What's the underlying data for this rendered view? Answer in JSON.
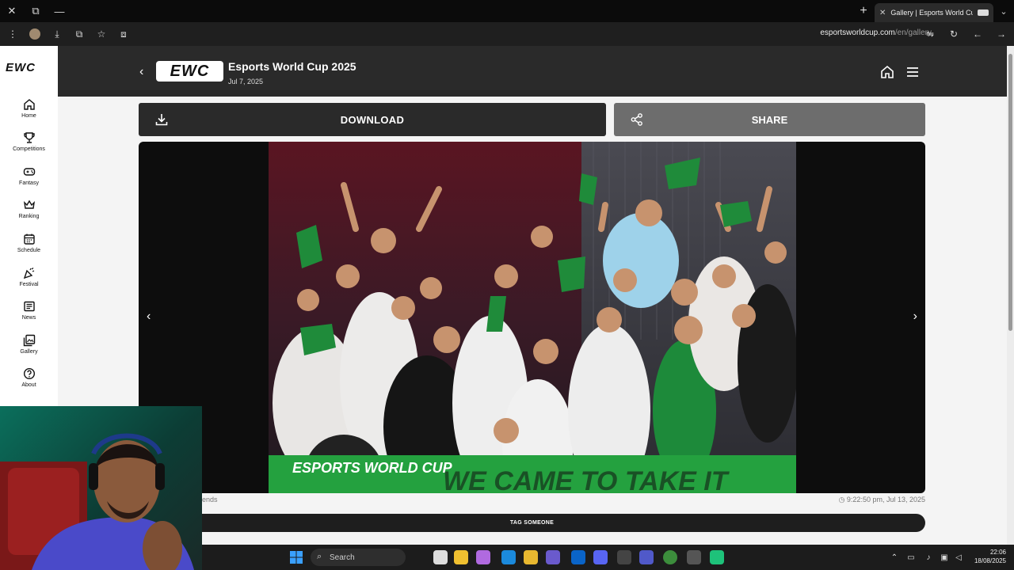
{
  "browser": {
    "tab_title": "Gallery | Esports World Cup",
    "url_domain": "esportsworldcup.com",
    "url_path": "/en/gallery"
  },
  "sidebar": {
    "logo": "EWC",
    "items": [
      {
        "label": "Home",
        "icon": "home-icon"
      },
      {
        "label": "Competitions",
        "icon": "trophy-icon"
      },
      {
        "label": "Fantasy",
        "icon": "gamepad-icon"
      },
      {
        "label": "Ranking",
        "icon": "crown-icon"
      },
      {
        "label": "Schedule",
        "icon": "calendar-icon"
      },
      {
        "label": "Festival",
        "icon": "party-popper-icon"
      },
      {
        "label": "News",
        "icon": "news-icon"
      },
      {
        "label": "Gallery",
        "icon": "gallery-icon"
      },
      {
        "label": "About",
        "icon": "help-icon"
      }
    ]
  },
  "header": {
    "brand": "EWC",
    "title": "Esports World Cup 2025",
    "date": "Jul 7, 2025"
  },
  "actions": {
    "download_label": "DOWNLOAD",
    "share_label": "SHARE"
  },
  "photo": {
    "banner_text": "ESPORTS WORLD CUP",
    "sign_text": "WE CAME TO TAKE IT"
  },
  "meta": {
    "left_text": "ends",
    "timestamp": "9:22:50 pm, Jul 13, 2025"
  },
  "tag_button_label": "TAG SOMEONE",
  "taskbar": {
    "search_placeholder": "Search",
    "time": "22:06",
    "date": "18/08/2025"
  },
  "colors": {
    "accent_green": "#1f8b3a",
    "header_dark": "#2a2a2a"
  }
}
